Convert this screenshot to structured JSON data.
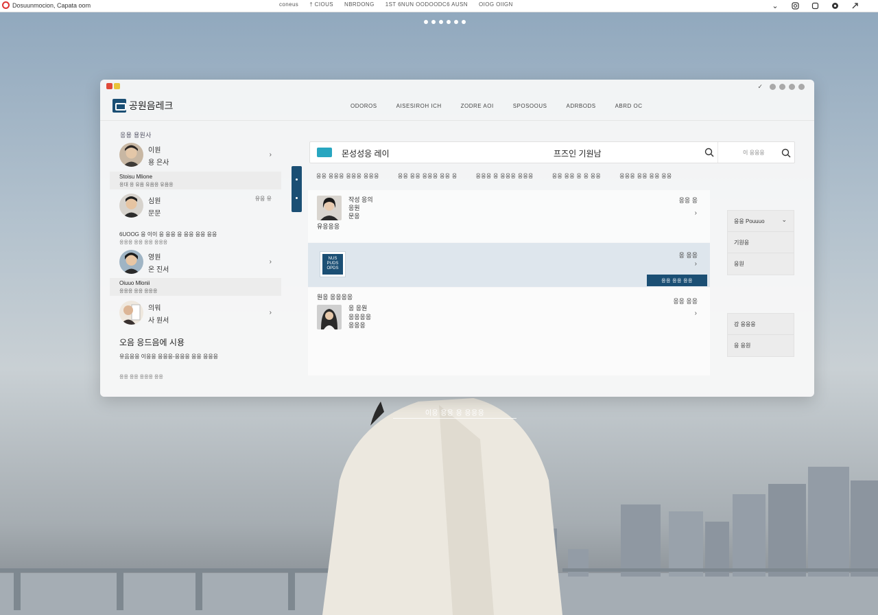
{
  "browser": {
    "app_title": "Dosuunmocion, Capata oom",
    "nav": [
      "coneus",
      "† CIOUS",
      "NBRDONG",
      "1ST 6NUN OODOODC6 AUSN",
      "OIOG OIIGN"
    ],
    "tools": [
      "chevron-down-icon",
      "instagram-icon",
      "square-icon",
      "settings-icon",
      "expand-icon"
    ]
  },
  "window": {
    "brand": "공원음레크",
    "menu": [
      "ODOROS",
      "AISESIROH ICH",
      "ZODRE AOI",
      "SPOSOOUS",
      "ADRBODS",
      "ABRD OC"
    ]
  },
  "left": {
    "section_title": "응용 용원사",
    "contacts": [
      {
        "name": "이원",
        "sub": "용 은사",
        "meta": ""
      },
      {
        "name": "심원",
        "sub": "문문",
        "meta": "유응 유"
      },
      {
        "name": "영원",
        "sub": "온 진서",
        "meta": ""
      },
      {
        "name": "의워",
        "sub": "사 원서",
        "meta": ""
      }
    ],
    "groups": [
      {
        "title": "Stoisu Mlione",
        "sub": "응대 응 유음 유음응 유음응"
      },
      {
        "title": "6UOOG 응 이이 응 응응 응 응응 응응 응응",
        "sub": "응응응 응응 응응 응응응"
      },
      {
        "title": "Oiuuo Mlonii",
        "sub": "응응응 응응 응응응"
      }
    ],
    "bottom_title": "오음 응드음에 시용",
    "bottom_line": "유음응응 이응응 응응응-응응응 응응 응응응",
    "bottom_sub": "응응 응응 응응응 응응"
  },
  "search": {
    "left_text": "몬성성응 레이",
    "mid_text": "프즈인 기원남",
    "placeholder": "이 응응응",
    "filters": [
      "응응 응응응 응응응 응응응",
      "응응 응응 응응응 응응 응",
      "응응응 응 응응응 응응응",
      "응응 응응 응 응 응응",
      "응응응 응응 응응 응응"
    ]
  },
  "cards": [
    {
      "l1": "작성 응의",
      "l2": "응원",
      "l3": "문응",
      "tag": "유응응응",
      "right": "응응 응"
    },
    {
      "badge": "NUS PUDS OPDS",
      "right": "응 응응",
      "button": "응응   응응 응응"
    },
    {
      "header": "원응 응응응응",
      "l1": "응 응원",
      "l2": "응응응응",
      "l3": "응응응",
      "right": "응응 응응"
    }
  ],
  "side_panel": {
    "top": [
      {
        "label": "응응 Pouuuo",
        "icon": "chevron-down-icon"
      },
      {
        "label": "기원응"
      },
      {
        "label": "응원"
      }
    ],
    "bottom": [
      {
        "label": "강 응응응"
      },
      {
        "label": "응 응원"
      }
    ]
  },
  "caption": "이응 응응 응 응응응",
  "colors": {
    "accent": "#1b4f74",
    "search_icon": "#28a6c0"
  }
}
